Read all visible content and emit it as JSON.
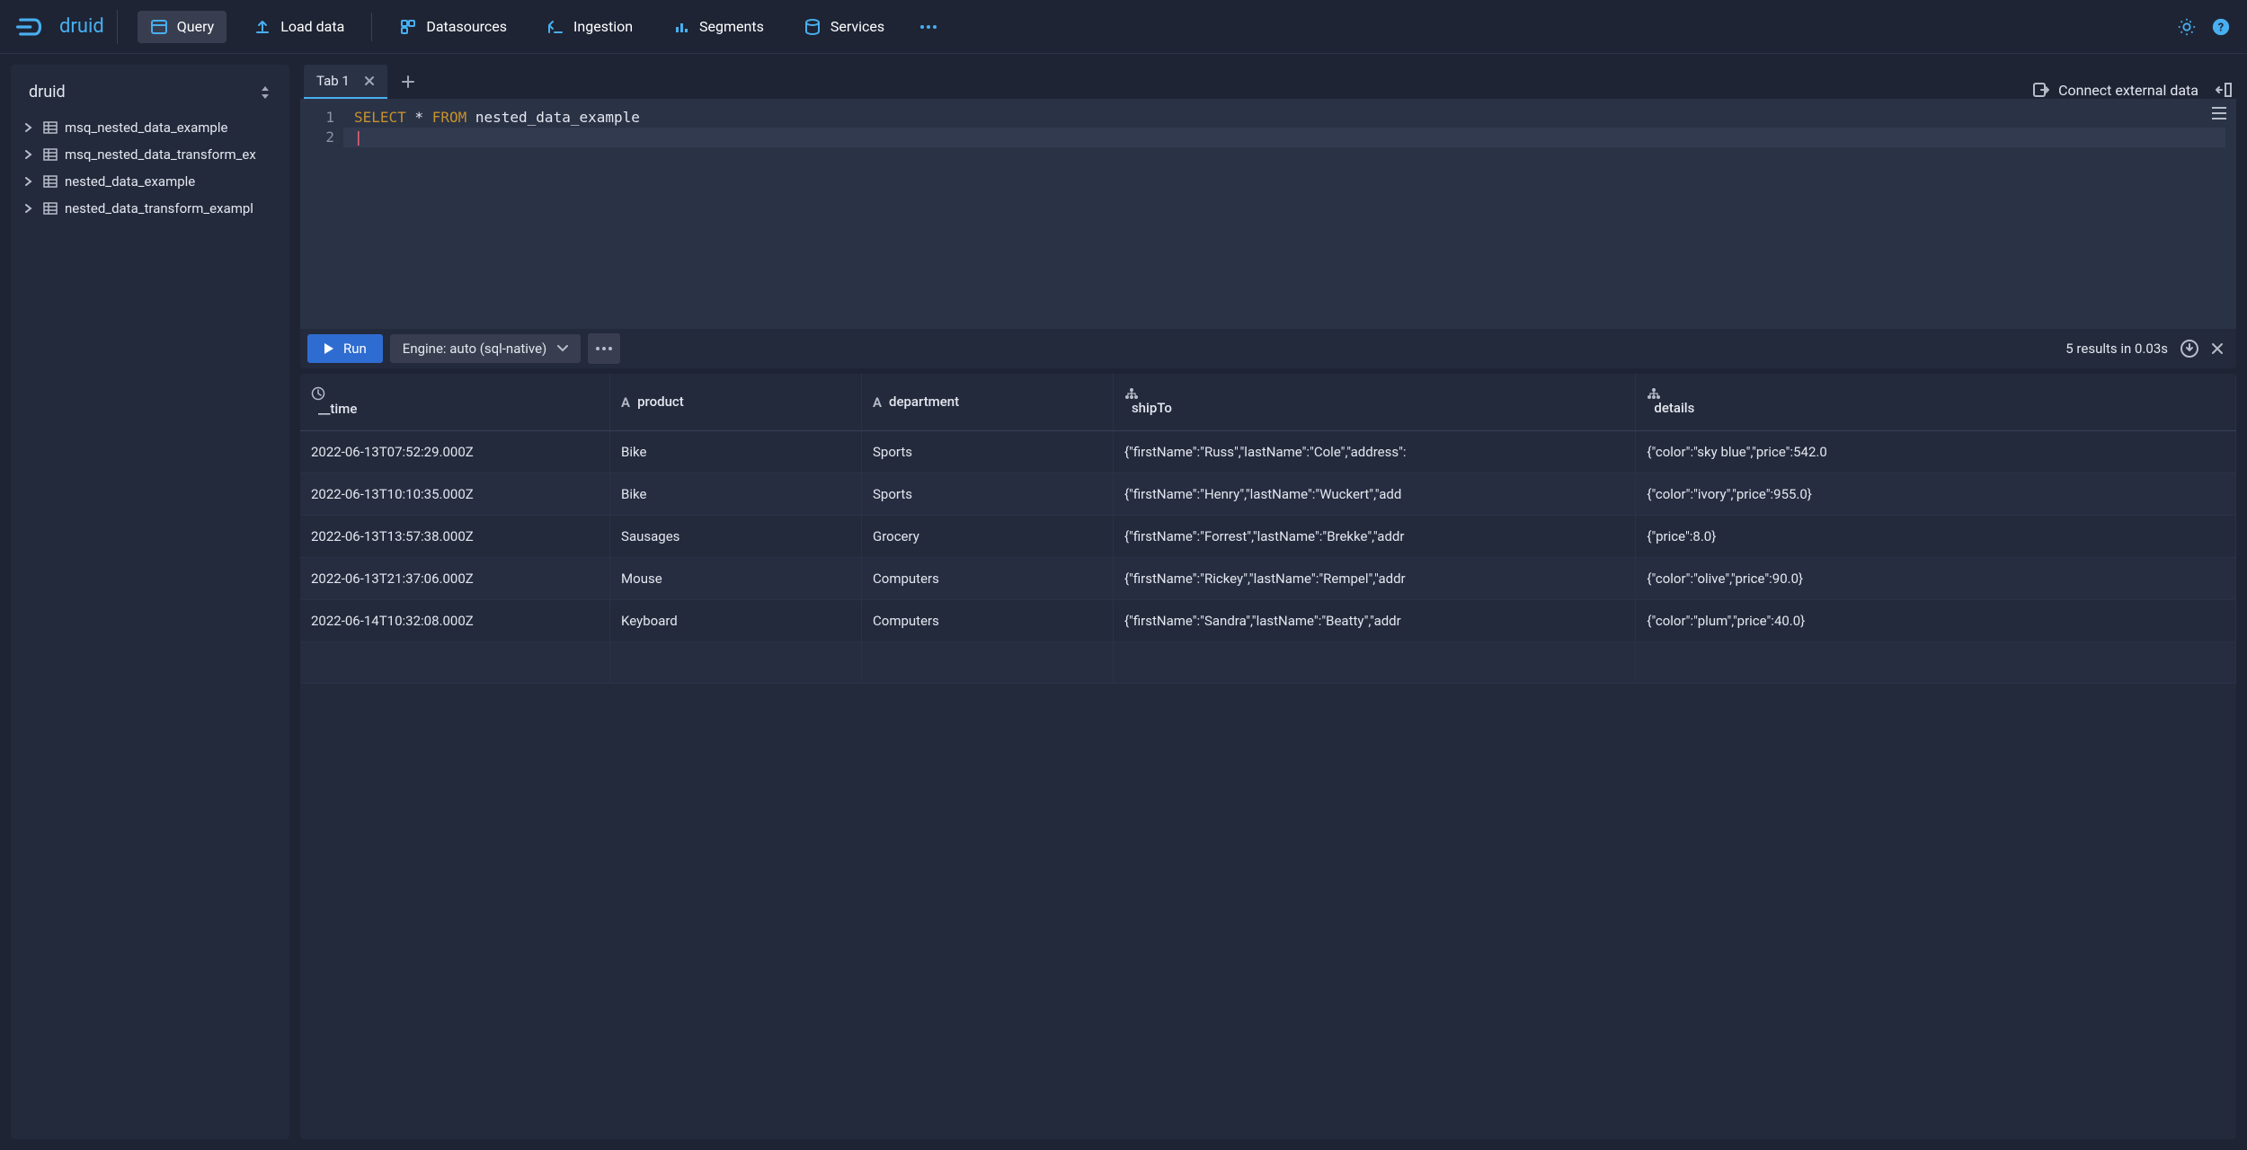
{
  "app_name": "druid",
  "nav": {
    "query": "Query",
    "load_data": "Load data",
    "datasources": "Datasources",
    "ingestion": "Ingestion",
    "segments": "Segments",
    "services": "Services"
  },
  "schema": {
    "selected": "druid",
    "tables": [
      "msq_nested_data_example",
      "msq_nested_data_transform_ex",
      "nested_data_example",
      "nested_data_transform_exampl"
    ]
  },
  "tabs": {
    "items": [
      {
        "label": "Tab 1",
        "active": true
      }
    ]
  },
  "connect_external_label": "Connect external data",
  "editor": {
    "lines": [
      {
        "n": "1",
        "tokens": [
          {
            "t": "SELECT",
            "cls": "kw"
          },
          {
            "t": " * ",
            "cls": ""
          },
          {
            "t": "FROM",
            "cls": "kw"
          },
          {
            "t": " nested_data_example",
            "cls": "tbl"
          }
        ]
      },
      {
        "n": "2",
        "tokens": [
          {
            "t": "",
            "cls": "cursor"
          }
        ]
      }
    ]
  },
  "toolbar": {
    "run_label": "Run",
    "engine_label": "Engine: auto (sql-native)",
    "results_status": "5 results in 0.03s"
  },
  "results": {
    "columns": [
      {
        "name": "__time",
        "type": "time"
      },
      {
        "name": "product",
        "type": "string"
      },
      {
        "name": "department",
        "type": "string"
      },
      {
        "name": "shipTo",
        "type": "nested"
      },
      {
        "name": "details",
        "type": "nested"
      }
    ],
    "rows": [
      {
        "__time": "2022-06-13T07:52:29.000Z",
        "product": "Bike",
        "department": "Sports",
        "shipTo": "{\"firstName\":\"Russ\",\"lastName\":\"Cole\",\"address\":",
        "details": "{\"color\":\"sky blue\",\"price\":542.0"
      },
      {
        "__time": "2022-06-13T10:10:35.000Z",
        "product": "Bike",
        "department": "Sports",
        "shipTo": "{\"firstName\":\"Henry\",\"lastName\":\"Wuckert\",\"add",
        "details": "{\"color\":\"ivory\",\"price\":955.0}"
      },
      {
        "__time": "2022-06-13T13:57:38.000Z",
        "product": "Sausages",
        "department": "Grocery",
        "shipTo": "{\"firstName\":\"Forrest\",\"lastName\":\"Brekke\",\"addr",
        "details": "{\"price\":8.0}"
      },
      {
        "__time": "2022-06-13T21:37:06.000Z",
        "product": "Mouse",
        "department": "Computers",
        "shipTo": "{\"firstName\":\"Rickey\",\"lastName\":\"Rempel\",\"addr",
        "details": "{\"color\":\"olive\",\"price\":90.0}"
      },
      {
        "__time": "2022-06-14T10:32:08.000Z",
        "product": "Keyboard",
        "department": "Computers",
        "shipTo": "{\"firstName\":\"Sandra\",\"lastName\":\"Beatty\",\"addr",
        "details": "{\"color\":\"plum\",\"price\":40.0}"
      }
    ]
  }
}
